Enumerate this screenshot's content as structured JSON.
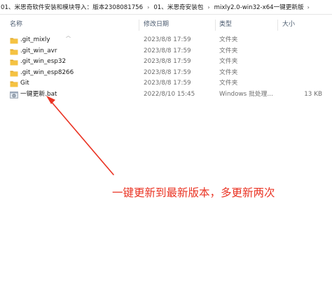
{
  "breadcrumb": {
    "items": [
      "01、米思奇软件安装和模块导入：版本2308081756",
      "01、米思奇安装包",
      "mixly2.0-win32-x64一键更新版"
    ]
  },
  "columns": {
    "name": "名称",
    "date": "修改日期",
    "type": "类型",
    "size": "大小"
  },
  "files": [
    {
      "name": ".git_mixly",
      "date": "2023/8/8 17:59",
      "type": "文件夹",
      "size": "",
      "icon": "folder-icon"
    },
    {
      "name": ".git_win_avr",
      "date": "2023/8/8 17:59",
      "type": "文件夹",
      "size": "",
      "icon": "folder-icon"
    },
    {
      "name": ".git_win_esp32",
      "date": "2023/8/8 17:59",
      "type": "文件夹",
      "size": "",
      "icon": "folder-icon"
    },
    {
      "name": ".git_win_esp8266",
      "date": "2023/8/8 17:59",
      "type": "文件夹",
      "size": "",
      "icon": "folder-icon"
    },
    {
      "name": "Git",
      "date": "2023/8/8 17:59",
      "type": "文件夹",
      "size": "",
      "icon": "folder-icon"
    },
    {
      "name": "一键更新.bat",
      "date": "2022/8/10 15:45",
      "type": "Windows 批处理...",
      "size": "13 KB",
      "icon": "batch-file-icon"
    }
  ],
  "annotation": {
    "text": "一键更新到最新版本，多更新两次",
    "color": "#ea3323"
  },
  "colors": {
    "folder": "#f5c242",
    "folder_dark": "#e0a82a",
    "header_text": "#4a5a6e",
    "muted_text": "#6d6d6d"
  }
}
